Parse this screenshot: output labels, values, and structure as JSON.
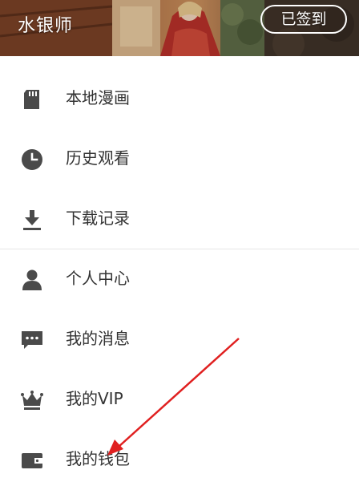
{
  "header": {
    "username": "水银师",
    "signin_label": "已签到"
  },
  "menu": {
    "items": [
      {
        "label": "本地漫画",
        "icon": "sd-card-icon"
      },
      {
        "label": "历史观看",
        "icon": "clock-icon"
      },
      {
        "label": "下载记录",
        "icon": "download-icon"
      },
      {
        "label": "个人中心",
        "icon": "person-icon"
      },
      {
        "label": "我的消息",
        "icon": "message-icon"
      },
      {
        "label": "我的VIP",
        "icon": "crown-icon"
      },
      {
        "label": "我的钱包",
        "icon": "wallet-icon"
      }
    ]
  },
  "colors": {
    "icon": "#4a4a4a",
    "text": "#333333",
    "annotation_arrow": "#e02020"
  }
}
